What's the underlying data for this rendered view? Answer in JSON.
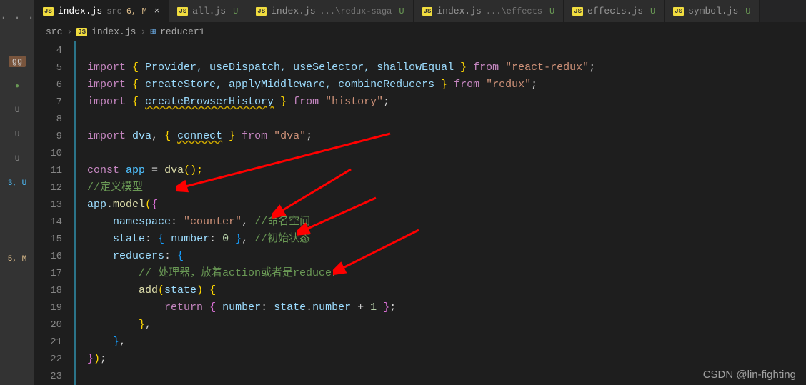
{
  "activity": {
    "dots": "· · ·",
    "badge": "gg",
    "items": [
      "●",
      "U",
      "U",
      "U",
      "3, U",
      "",
      "",
      "5, M"
    ]
  },
  "tabs": [
    {
      "icon": "JS",
      "name": "index.js",
      "suffix": "src",
      "mod": "6, M",
      "close": "×",
      "active": true
    },
    {
      "icon": "JS",
      "name": "all.js",
      "u": "U"
    },
    {
      "icon": "JS",
      "name": "index.js",
      "path": "...\\redux-saga",
      "u": "U"
    },
    {
      "icon": "JS",
      "name": "index.js",
      "path": "...\\effects",
      "u": "U"
    },
    {
      "icon": "JS",
      "name": "effects.js",
      "u": "U"
    },
    {
      "icon": "JS",
      "name": "symbol.js",
      "u": "U"
    }
  ],
  "breadcrumb": {
    "parts": [
      "src",
      "index.js",
      "reducer1"
    ],
    "sep": "›"
  },
  "lineStart": 4,
  "lineEnd": 23,
  "code": {
    "l5": {
      "kw": "import",
      "p1": " { ",
      "v": "Provider, useDispatch, useSelector, shallowEqual",
      "p2": " } ",
      "from": "from",
      "sp": " ",
      "str": "\"react-redux\"",
      "end": ";"
    },
    "l6": {
      "kw": "import",
      "p1": " { ",
      "v": "createStore, applyMiddleware, combineReducers",
      "p2": " } ",
      "from": "from",
      "sp": " ",
      "str": "\"redux\"",
      "end": ";"
    },
    "l7": {
      "kw": "import",
      "p1": " { ",
      "v": "createBrowserHistory",
      "p2": " } ",
      "from": "from",
      "sp": " ",
      "str": "\"history\"",
      "end": ";"
    },
    "l9": {
      "kw": "import",
      "sp": " ",
      "v1": "dva",
      "c": ", ",
      "p1": "{ ",
      "v2": "connect",
      "p2": " } ",
      "from": "from",
      "sp2": " ",
      "str": "\"dva\"",
      "end": ";"
    },
    "l11": {
      "kw": "const",
      "sp": " ",
      "v": "app",
      "eq": " = ",
      "fn": "dva",
      "par": "();"
    },
    "l12": {
      "cmt": "//定义模型"
    },
    "l13": {
      "v": "app",
      "dot": ".",
      "fn": "model",
      "par": "({ "
    },
    "l14": {
      "indent": "    ",
      "key": "namespace",
      "col": ": ",
      "str": "\"counter\"",
      "c": ", ",
      "cmt": "//命名空间"
    },
    "l15": {
      "indent": "    ",
      "key": "state",
      "col": ": ",
      "p1": "{ ",
      "key2": "number",
      "col2": ": ",
      "num": "0",
      "p2": " }, ",
      "cmt": "//初始状态"
    },
    "l16": {
      "indent": "    ",
      "key": "reducers",
      "col": ": ",
      "p1": "{"
    },
    "l17": {
      "indent": "        ",
      "cmt": "// 处理器，放着action或者是reducer"
    },
    "l18": {
      "indent": "        ",
      "fn": "add",
      "par": "(",
      "arg": "state",
      "par2": ") {"
    },
    "l19": {
      "indent": "            ",
      "kw": "return",
      "sp": " ",
      "p1": "{ ",
      "key": "number",
      "col": ": ",
      "v": "state",
      "dot": ".",
      "prop": "number",
      "op": " + ",
      "num": "1",
      "p2": " };"
    },
    "l20": {
      "indent": "        ",
      "p": "},"
    },
    "l21": {
      "indent": "    ",
      "p": "},"
    },
    "l22": {
      "p": "});"
    }
  },
  "watermark": "CSDN @lin-fighting"
}
